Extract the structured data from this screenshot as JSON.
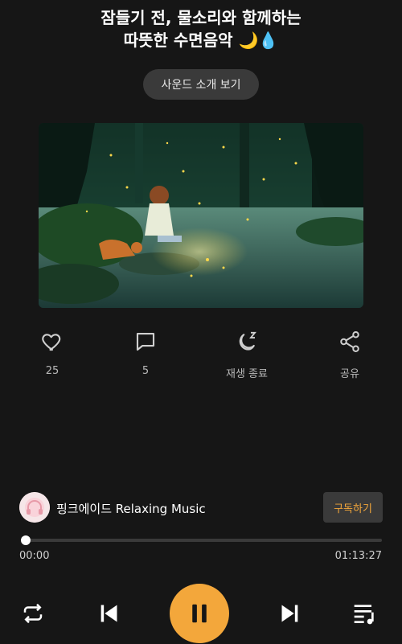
{
  "header": {
    "title_line1": "잠들기 전, 물소리와 함께하는",
    "title_line2": "따뜻한 수면음악 🌙💧"
  },
  "intro_button": {
    "label": "사운드 소개 보기"
  },
  "actions": [
    {
      "icon": "heart-icon",
      "label": "25"
    },
    {
      "icon": "comment-icon",
      "label": "5"
    },
    {
      "icon": "sleep-timer-icon",
      "label": "재생 종료"
    },
    {
      "icon": "share-icon",
      "label": "공유"
    }
  ],
  "channel": {
    "name": "핑크에이드 Relaxing Music",
    "subscribe_label": "구독하기"
  },
  "player": {
    "current_time": "00:00",
    "total_time": "01:13:27",
    "progress_fraction": 0.0
  },
  "colors": {
    "accent": "#f3a73b",
    "background": "#161616",
    "button_bg": "#3a3a3a"
  }
}
